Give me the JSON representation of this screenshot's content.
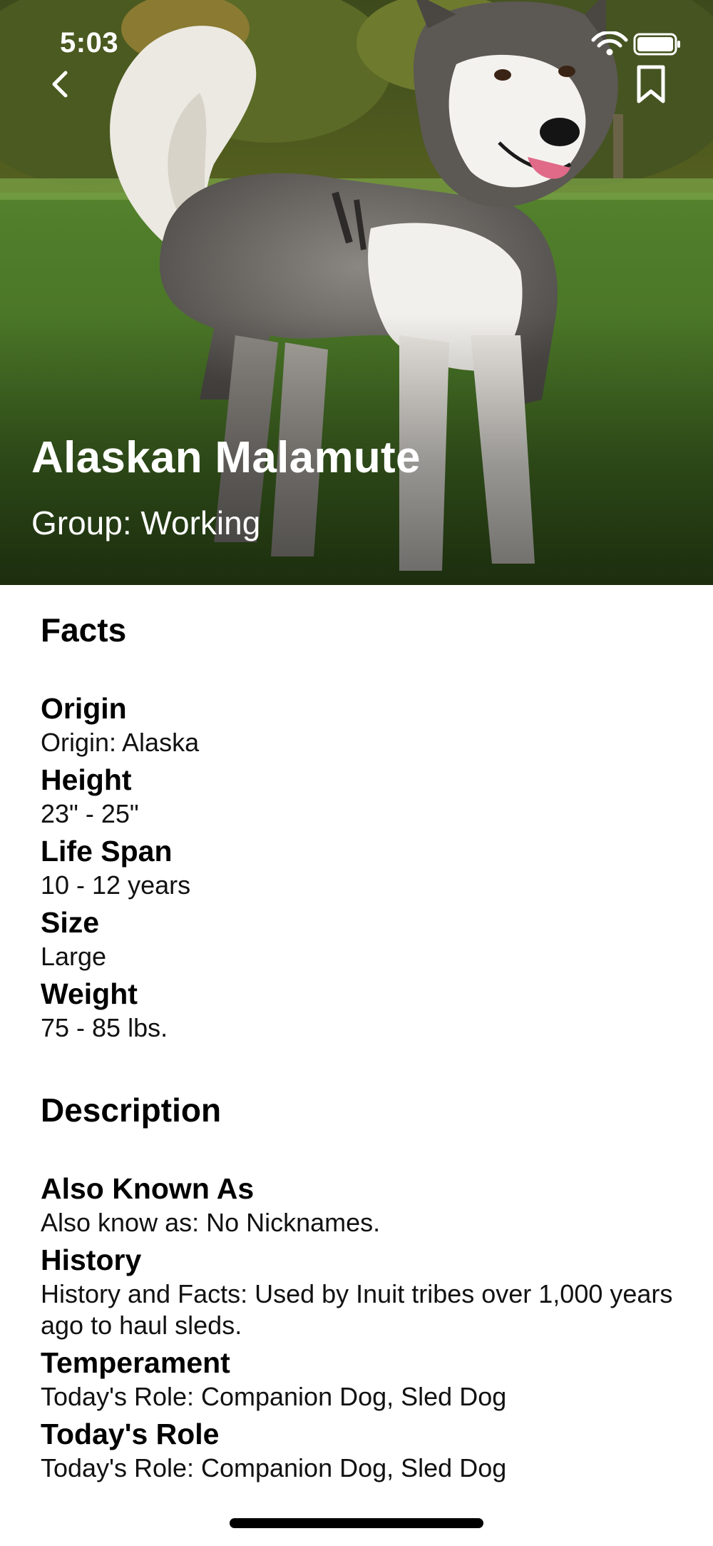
{
  "status": {
    "time": "5:03"
  },
  "header": {
    "breed_name": "Alaskan Malamute",
    "group": "Group: Working"
  },
  "facts": {
    "title": "Facts",
    "items": [
      {
        "label": "Origin",
        "value": "Origin: Alaska"
      },
      {
        "label": "Height",
        "value": "23\" - 25\""
      },
      {
        "label": "Life Span",
        "value": "10 - 12 years"
      },
      {
        "label": "Size",
        "value": "Large"
      },
      {
        "label": "Weight",
        "value": "75 - 85 lbs."
      }
    ]
  },
  "description": {
    "title": "Description",
    "items": [
      {
        "label": "Also Known As",
        "value": "Also know as: No Nicknames."
      },
      {
        "label": "History",
        "value": "History and Facts: Used by Inuit tribes over 1,000 years ago to haul sleds."
      },
      {
        "label": "Temperament",
        "value": "Today's Role: Companion Dog, Sled Dog"
      },
      {
        "label": "Today's Role",
        "value": "Today's Role: Companion Dog, Sled Dog"
      }
    ]
  },
  "icons": {
    "back": "chevron-left-icon",
    "bookmark": "bookmark-icon",
    "wifi": "wifi-icon",
    "battery": "battery-icon"
  }
}
